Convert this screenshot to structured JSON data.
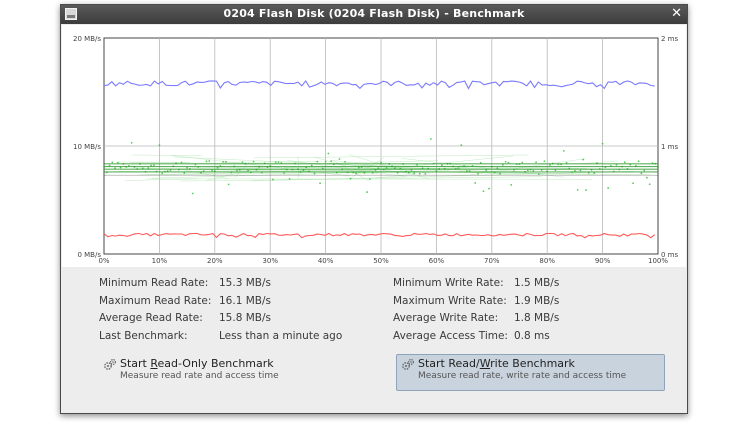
{
  "window": {
    "title": "0204 Flash Disk (0204 Flash Disk) - Benchmark",
    "close_glyph": "✕"
  },
  "chart_data": {
    "type": "line",
    "title": "",
    "left_axis": {
      "ticks": [
        "20 MB/s",
        "10 MB/s",
        "0 MB/s"
      ],
      "min": 0,
      "max": 20,
      "unit": "MB/s"
    },
    "right_axis": {
      "ticks": [
        "2 ms",
        "1 ms",
        "0 ms"
      ],
      "min": 0,
      "max": 2,
      "unit": "ms"
    },
    "x_axis": {
      "ticks": [
        "0%",
        "10%",
        "20%",
        "30%",
        "40%",
        "50%",
        "60%",
        "70%",
        "80%",
        "90%",
        "100%"
      ],
      "min": 0,
      "max": 100
    },
    "grid": true,
    "series": [
      {
        "name": "Read rate",
        "color": "#7b7bff",
        "axis": "left",
        "mean": 15.8,
        "min": 15.3,
        "max": 16.1
      },
      {
        "name": "Write rate",
        "color": "#ff5a5a",
        "axis": "left",
        "mean": 1.8,
        "min": 1.5,
        "max": 1.9
      },
      {
        "name": "Access time",
        "color": "#22bb22",
        "axis": "right",
        "mean": 0.8,
        "style": "scatter"
      }
    ]
  },
  "stats": {
    "left": [
      {
        "label": "Minimum Read Rate:",
        "value": "15.3 MB/s"
      },
      {
        "label": "Maximum Read Rate:",
        "value": "16.1 MB/s"
      },
      {
        "label": "Average Read Rate:",
        "value": "15.8 MB/s"
      },
      {
        "label": "Last Benchmark:",
        "value": "Less than a minute ago"
      }
    ],
    "right": [
      {
        "label": "Minimum Write Rate:",
        "value": "1.5 MB/s"
      },
      {
        "label": "Maximum Write Rate:",
        "value": "1.9 MB/s"
      },
      {
        "label": "Average Write Rate:",
        "value": "1.8 MB/s"
      },
      {
        "label": "Average Access Time:",
        "value": "0.8 ms"
      }
    ]
  },
  "buttons": {
    "read_only": {
      "title": "Start Read-Only Benchmark",
      "mnemonic": "R",
      "description": "Measure read rate and access time",
      "icon": "gears-icon"
    },
    "read_write": {
      "title": "Start Read/Write Benchmark",
      "mnemonic": "W",
      "description": "Measure read rate, write rate and access time",
      "icon": "gears-icon"
    }
  }
}
